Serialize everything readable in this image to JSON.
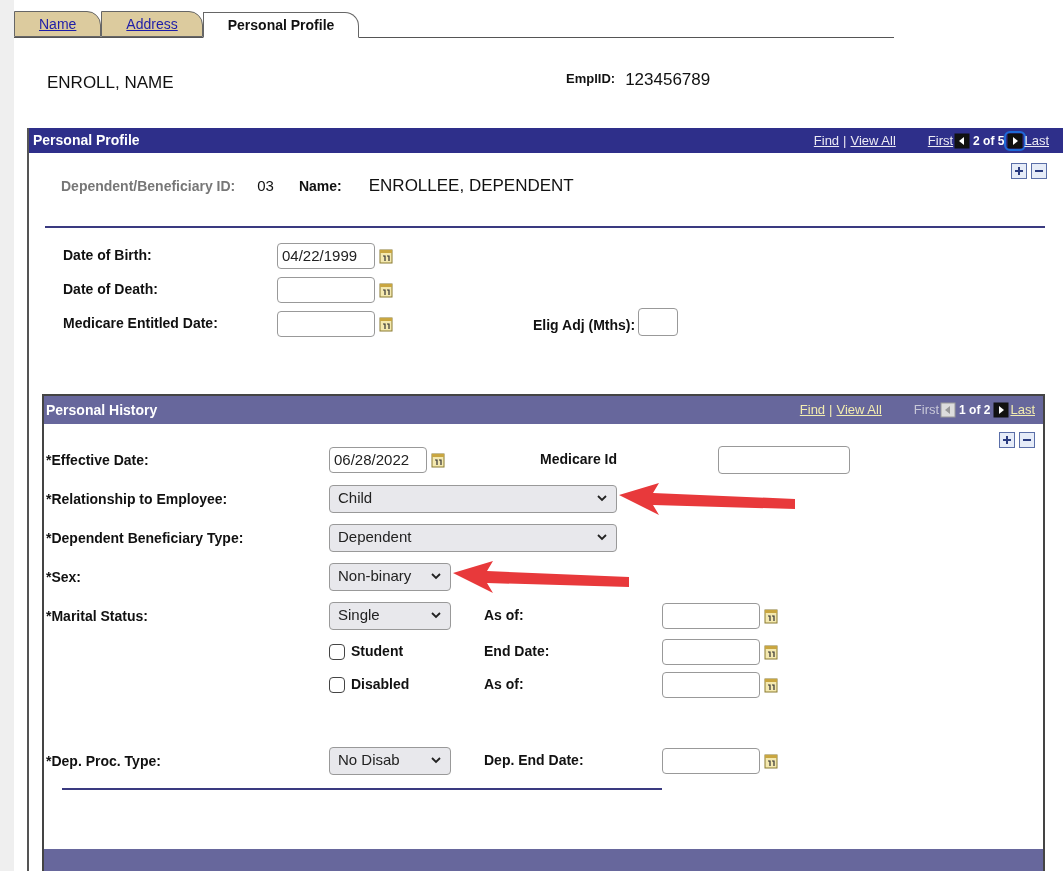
{
  "tabs": [
    {
      "label": "Name",
      "selected": false
    },
    {
      "label": "Address",
      "selected": false
    },
    {
      "label": "Personal Profile",
      "selected": true
    }
  ],
  "header": {
    "name": "ENROLL, NAME",
    "emplid_label": "EmplID:",
    "emplid": "123456789"
  },
  "profile": {
    "title": "Personal Profile",
    "nav": {
      "find": "Find",
      "separator": "|",
      "view_all": "View All",
      "first": {
        "label": "First",
        "enabled": true
      },
      "prev_enabled": true,
      "count": "2 of 5",
      "next_enabled": true,
      "last": {
        "label": "Last",
        "enabled": true
      }
    },
    "id_label": "Dependent/Beneficiary ID:",
    "id": "03",
    "name_label": "Name:",
    "name": "ENROLLEE, DEPENDENT",
    "dates": [
      {
        "label": "Date of Birth:",
        "value": "04/22/1999"
      },
      {
        "label": "Date of Death:"
      },
      {
        "label": "Medicare Entitled Date:"
      }
    ],
    "elig_label": "Elig Adj (Mths):"
  },
  "history": {
    "title": "Personal History",
    "nav": {
      "find": "Find",
      "separator": "|",
      "view_all": "View All",
      "first": {
        "label": "First",
        "enabled": false
      },
      "prev_enabled": false,
      "count": "1 of 2",
      "next_enabled": true,
      "last": {
        "label": "Last",
        "enabled": true
      }
    },
    "rows": [
      {
        "kind": "date",
        "label": "*Effective Date:",
        "value": "06/28/2022",
        "side": {
          "kind": "text",
          "label": "Medicare Id"
        }
      },
      {
        "kind": "wide-select",
        "label": "*Relationship to Employee:",
        "value": "Child",
        "annotated": true
      },
      {
        "kind": "wide-select",
        "label": "*Dependent Beneficiary Type:",
        "value": "Dependent"
      },
      {
        "kind": "select",
        "label": "*Sex:",
        "value": "Non-binary",
        "annotated": true
      },
      {
        "kind": "select",
        "label": "*Marital Status:",
        "value": "Single",
        "side": {
          "kind": "date",
          "label": "As of:"
        }
      },
      {
        "kind": "checkbox",
        "label": "Student",
        "checked": false,
        "side": {
          "kind": "date",
          "label": "End Date:"
        }
      },
      {
        "kind": "checkbox",
        "label": "Disabled",
        "checked": false,
        "side": {
          "kind": "date",
          "label": "As of:"
        }
      },
      {
        "kind": "spacer"
      },
      {
        "kind": "select",
        "label": "*Dep. Proc. Type:",
        "value": "No Disab",
        "side": {
          "kind": "date",
          "label": "Dep. End Date:"
        }
      }
    ]
  }
}
